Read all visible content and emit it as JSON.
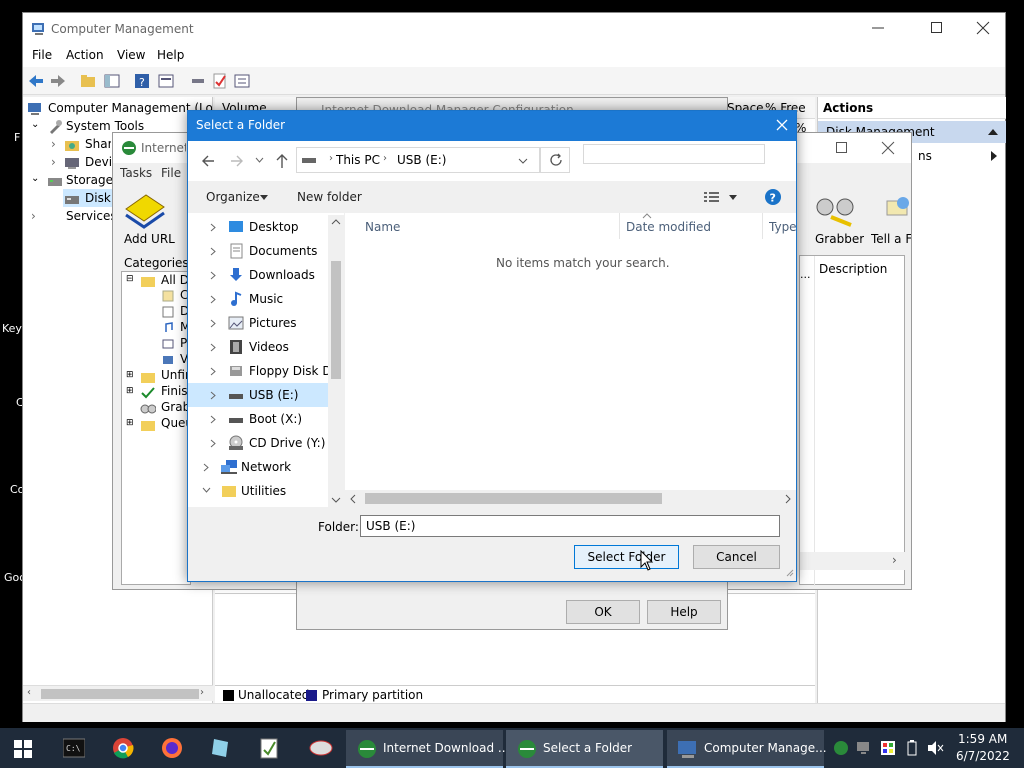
{
  "desktop": {
    "fragments": [
      "F",
      "Key",
      "C",
      "Co",
      "Goo"
    ]
  },
  "computer_management": {
    "title": "Computer Management",
    "menu": [
      "File",
      "Action",
      "View",
      "Help"
    ],
    "tree": {
      "root": "Computer Management (Local",
      "system_tools": "System Tools",
      "shared": "Share",
      "device": "Devic",
      "storage": "Storage",
      "disk": "Disk M",
      "services": "Services a"
    },
    "center": {
      "volume_header": "Volume",
      "free_space_header": "Space",
      "pct_free_header": "% Free",
      "pct": "%",
      "legend_unallocated": "Unallocated",
      "legend_primary": "Primary partition"
    },
    "actions": {
      "header": "Actions",
      "disk_management": "Disk Management",
      "more_actions": "ns"
    }
  },
  "idm": {
    "title": "Internet",
    "menu": [
      "Tasks",
      "File"
    ],
    "add_url": "Add URL",
    "grabber": "Grabber",
    "tell_friend": "Tell a Fri",
    "categories_label": "Categories",
    "categories": [
      "All Do",
      "C",
      "D",
      "M",
      "P",
      "V",
      "Unfin",
      "Finish",
      "Grab",
      "Queu"
    ],
    "description_header": "Description",
    "ellipsis": "..."
  },
  "config_dialog": {
    "title": "Internet Download Manager Configuration",
    "ok": "OK",
    "help": "Help"
  },
  "select_folder": {
    "title": "Select a Folder",
    "breadcrumb": [
      "This PC",
      "USB (E:)"
    ],
    "search_placeholder": "",
    "organize": "Organize",
    "new_folder": "New folder",
    "nav_items": [
      {
        "label": "Desktop",
        "icon": "desktop-folder-icon"
      },
      {
        "label": "Documents",
        "icon": "documents-folder-icon"
      },
      {
        "label": "Downloads",
        "icon": "downloads-folder-icon"
      },
      {
        "label": "Music",
        "icon": "music-folder-icon"
      },
      {
        "label": "Pictures",
        "icon": "pictures-folder-icon"
      },
      {
        "label": "Videos",
        "icon": "videos-folder-icon"
      },
      {
        "label": "Floppy Disk Dri",
        "icon": "floppy-drive-icon"
      },
      {
        "label": "USB (E:)",
        "icon": "usb-drive-icon",
        "selected": true
      },
      {
        "label": "Boot (X:)",
        "icon": "drive-icon"
      },
      {
        "label": "CD Drive (Y:) H",
        "icon": "cd-drive-icon"
      },
      {
        "label": "Network",
        "icon": "network-icon"
      },
      {
        "label": "Utilities",
        "icon": "folder-icon"
      }
    ],
    "columns": [
      "Name",
      "Date modified",
      "Type"
    ],
    "empty_message": "No items match your search.",
    "folder_label": "Folder:",
    "folder_value": "USB (E:)",
    "select_button": "Select Folder",
    "cancel_button": "Cancel"
  },
  "taskbar": {
    "apps": [
      {
        "label": "Internet Download ...",
        "icon": "idm-icon"
      },
      {
        "label": "Select a Folder",
        "icon": "idm-icon",
        "active": true
      },
      {
        "label": "Computer Manage...",
        "icon": "computer-management-icon"
      }
    ],
    "clock_time": "1:59 AM",
    "clock_date": "6/7/2022"
  }
}
